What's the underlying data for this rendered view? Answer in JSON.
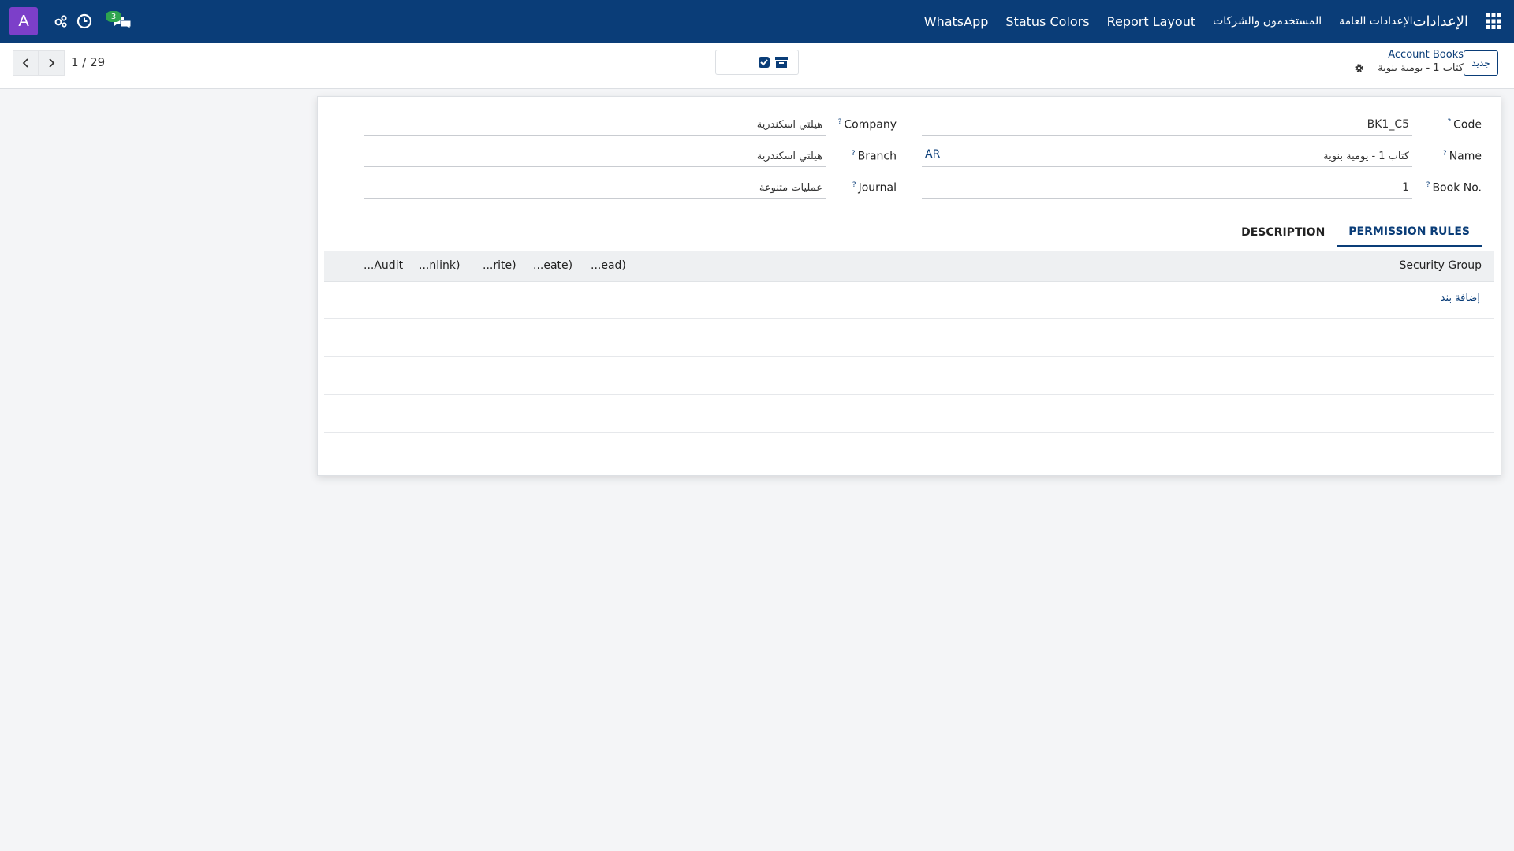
{
  "navbar": {
    "avatar_letter": "A",
    "chat_badge": "3",
    "brand": "الإعدادات",
    "menu": [
      "الإعدادات العامة",
      "المستخدمون والشركات",
      "Report Layout",
      "Status Colors",
      "WhatsApp"
    ],
    "icons": [
      "apps-grid-icon",
      "chat-icon",
      "clock-icon",
      "tools-icon"
    ]
  },
  "control": {
    "pager": "1 / 29",
    "new_label": "جديد",
    "breadcrumb_root": "Account Books",
    "breadcrumb_current": "كتاب 1 - يومية بنوية"
  },
  "form": {
    "code": {
      "label": "Code",
      "value": "BK1_C5"
    },
    "name": {
      "label": "Name",
      "value": "كتاب 1 - يومية بنوية",
      "lang": "AR"
    },
    "book_no": {
      "label": "Book No.",
      "value": "1"
    },
    "company": {
      "label": "Company",
      "value": "هيلتي اسكندرية"
    },
    "branch": {
      "label": "Branch",
      "value": "هيلتي اسكندرية"
    },
    "journal": {
      "label": "Journal",
      "value": "عمليات متنوعة"
    },
    "help_mark": "?"
  },
  "tabs": [
    {
      "label": "PERMISSION RULES",
      "active": true
    },
    {
      "label": "DESCRIPTION",
      "active": false
    }
  ],
  "table": {
    "columns": [
      "Security Group",
      "...ead)",
      "...eate)",
      "...rite)",
      "...nlink)",
      "...Audit"
    ],
    "add_line": "إضافة بند"
  },
  "colors": {
    "navbar": "#0a3d78",
    "accent": "#0a3d78",
    "avatar": "#7c3fc9",
    "badge": "#2ea44f"
  }
}
